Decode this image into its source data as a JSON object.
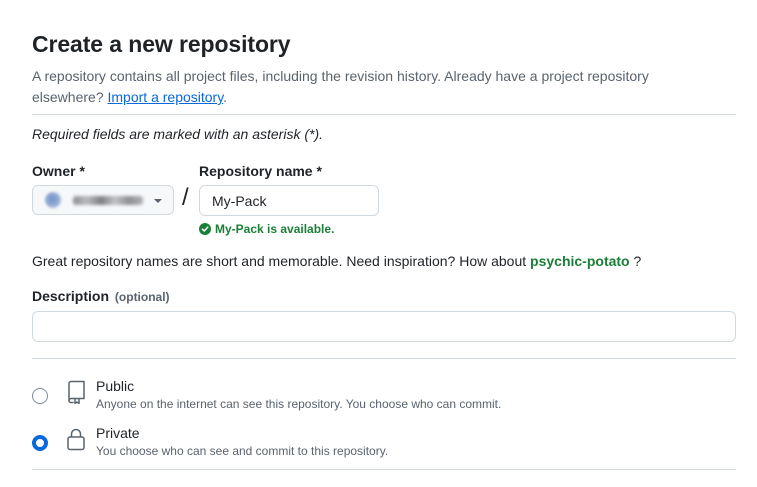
{
  "header": {
    "title": "Create a new repository",
    "subtitle_prefix": "A repository contains all project files, including the revision history. Already have a project repository elsewhere?",
    "import_link": "Import a repository",
    "subtitle_suffix": "."
  },
  "required_note": "Required fields are marked with an asterisk (*).",
  "owner": {
    "label": "Owner *",
    "selected_value": ""
  },
  "separator": "/",
  "repository": {
    "label": "Repository name *",
    "value": "My-Pack",
    "availability": "My-Pack is available."
  },
  "inspiration": {
    "text": "Great repository names are short and memorable. Need inspiration? How about",
    "suggestion": "psychic-potato",
    "suffix": "?"
  },
  "description": {
    "label": "Description",
    "optional": "(optional)",
    "value": "",
    "placeholder": ""
  },
  "visibility": {
    "selected": "private",
    "options": [
      {
        "id": "public",
        "title": "Public",
        "description": "Anyone on the internet can see this repository. You choose who can commit.",
        "icon": "repo-icon"
      },
      {
        "id": "private",
        "title": "Private",
        "description": "You choose who can see and commit to this repository.",
        "icon": "lock-icon"
      }
    ]
  },
  "colors": {
    "accent": "#0969da",
    "success": "#1a7f37",
    "muted": "#59636e",
    "border": "#d1d9e0"
  }
}
